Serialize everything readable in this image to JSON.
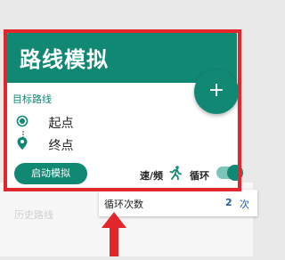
{
  "header": {
    "title": "路线模拟"
  },
  "fab": {
    "icon": "plus-icon",
    "label": "+"
  },
  "route": {
    "section_label": "目标路线",
    "origin_label": "起点",
    "destination_label": "终点"
  },
  "controls": {
    "start_button": "启动模拟",
    "speed_label": "速/频",
    "loop_label": "循环",
    "loop_enabled": true
  },
  "history": {
    "label": "历史路线"
  },
  "popup": {
    "label": "循环次数",
    "value": "2",
    "extra": "次"
  },
  "colors": {
    "accent": "#108873",
    "highlight": "#e2262c",
    "value": "#1f5ea8"
  }
}
